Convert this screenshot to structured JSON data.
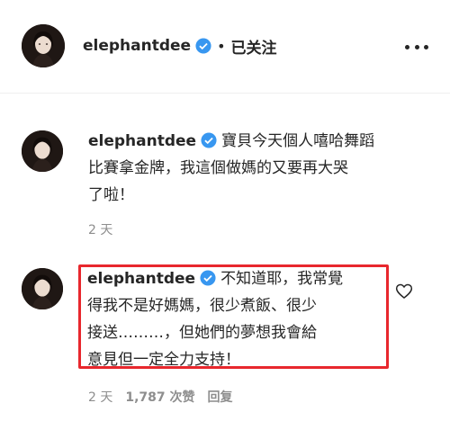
{
  "header": {
    "username": "elephantdee",
    "dot": "•",
    "follow_status": "已关注",
    "icons": {
      "verified": "verified-badge-icon",
      "more": "more-options-icon"
    }
  },
  "comments": [
    {
      "username": "elephantdee",
      "text_line1": "寶貝今天個人嘻哈舞蹈",
      "text_line2": "比賽拿金牌，我這個做媽的又要再大哭",
      "text_line3": "了啦！",
      "time": "2 天"
    },
    {
      "username": "elephantdee",
      "text_line1": "不知道耶，我常覺",
      "text_line2": "得我不是好媽媽，很少煮飯、很少",
      "text_line3": "接送………，但她們的夢想我會給",
      "text_line4": "意見但一定全力支持！",
      "time": "2 天",
      "likes": "1,787 次赞",
      "reply": "回复",
      "icons": {
        "like": "heart-icon"
      }
    }
  ],
  "colors": {
    "verified_blue": "#3897f0",
    "highlight_red": "#e8272d",
    "meta_gray": "#8e8e8e"
  }
}
